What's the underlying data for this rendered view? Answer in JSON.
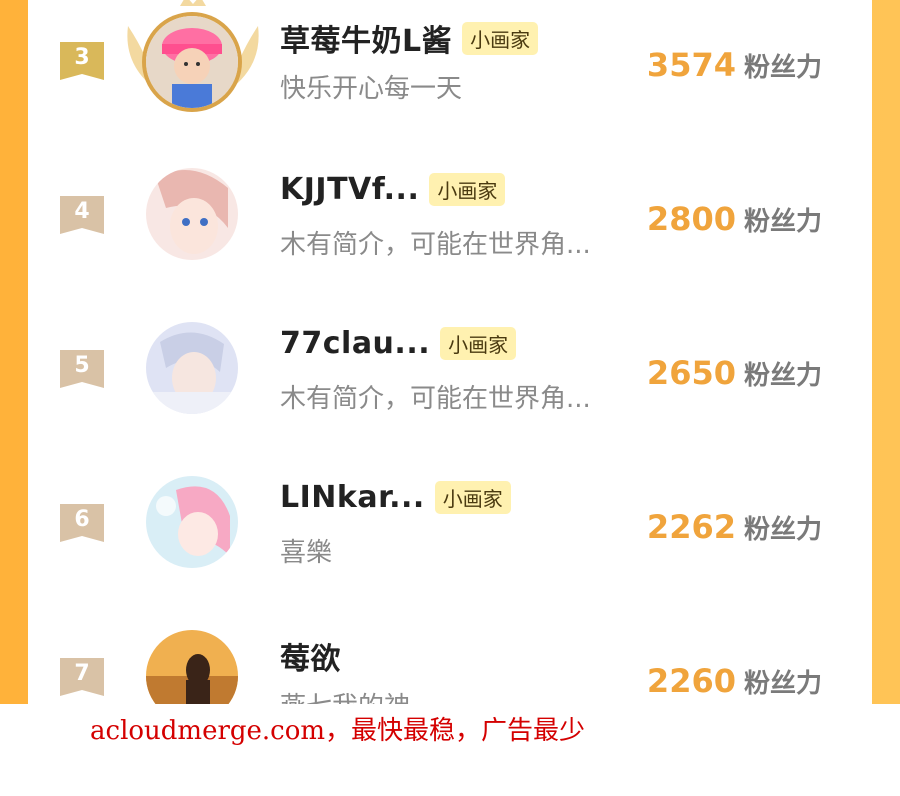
{
  "colors": {
    "page_bg": "#ffb23a",
    "card_bg": "#ffffff",
    "fans_number": "#f0a43c",
    "badge_bg": "#fff1b0",
    "rank_top_badge": "#d9b85a",
    "rank_badge": "#d9c2a6",
    "watermark": "#d40000"
  },
  "ranking": [
    {
      "rank": "3",
      "name": "草莓牛奶L酱",
      "badge": "小画家",
      "bio": "快乐开心每一天",
      "fans": "3574",
      "fans_unit": "粉丝力",
      "avatar_icon": "child-pink-hat-avatar"
    },
    {
      "rank": "4",
      "name": "KJJTVf...",
      "badge": "小画家",
      "bio": "木有简介，可能在世界角...",
      "fans": "2800",
      "fans_unit": "粉丝力",
      "avatar_icon": "anime-girl-avatar"
    },
    {
      "rank": "5",
      "name": "77clau...",
      "badge": "小画家",
      "bio": "木有简介，可能在世界角...",
      "fans": "2650",
      "fans_unit": "粉丝力",
      "avatar_icon": "anime-boy-avatar"
    },
    {
      "rank": "6",
      "name": "LINkar...",
      "badge": "小画家",
      "bio": "喜樂",
      "fans": "2262",
      "fans_unit": "粉丝力",
      "avatar_icon": "pink-hair-girl-avatar"
    },
    {
      "rank": "7",
      "name": "莓欲",
      "badge": "",
      "bio": "燕七我的神",
      "fans": "2260",
      "fans_unit": "粉丝力",
      "avatar_icon": "sunset-silhouette-avatar"
    }
  ],
  "watermark": "acloudmerge.com，最快最稳，广告最少"
}
